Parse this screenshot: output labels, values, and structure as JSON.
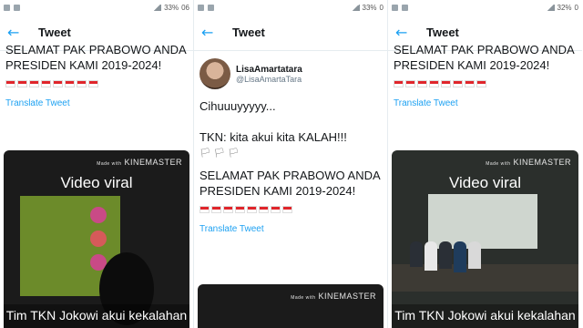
{
  "panels": [
    {
      "status": {
        "battery": "33%",
        "time": "06"
      },
      "appbar_title": "Tweet",
      "tweet_text": "SELAMAT PAK PRABOWO ANDA\nPRESIDEN KAMI 2019-2024!",
      "translate_label": "Translate Tweet",
      "video": {
        "watermark_small": "Made with",
        "watermark": "KINEMASTER",
        "title": "Video viral",
        "caption": "Tim TKN Jokowi akui kekalahan"
      }
    },
    {
      "status": {
        "battery": "33%",
        "time": "0"
      },
      "appbar_title": "Tweet",
      "user": {
        "name": "LisaAmartatara",
        "handle": "@LisaAmartaTara"
      },
      "tweet_text": "Cihuuuyyyyy...\n\nTKN: kita akui kita KALAH!!!",
      "emoji_line": "🏳 🏳 🏳",
      "tweet_text_2": "SELAMAT PAK PRABOWO ANDA\nPRESIDEN KAMI 2019-2024!",
      "translate_label": "Translate Tweet",
      "video": {
        "watermark_small": "Made with",
        "watermark": "KINEMASTER"
      }
    },
    {
      "status": {
        "battery": "32%",
        "time": "0"
      },
      "appbar_title": "Tweet",
      "tweet_text": "SELAMAT PAK PRABOWO ANDA\nPRESIDEN KAMI 2019-2024!",
      "translate_label": "Translate Tweet",
      "video": {
        "watermark_small": "Made with",
        "watermark": "KINEMASTER",
        "title": "Video viral",
        "caption": "Tim TKN Jokowi akui kekalahan"
      }
    }
  ],
  "colors": {
    "accent": "#1da1f2",
    "flag_red": "#e0252b"
  }
}
